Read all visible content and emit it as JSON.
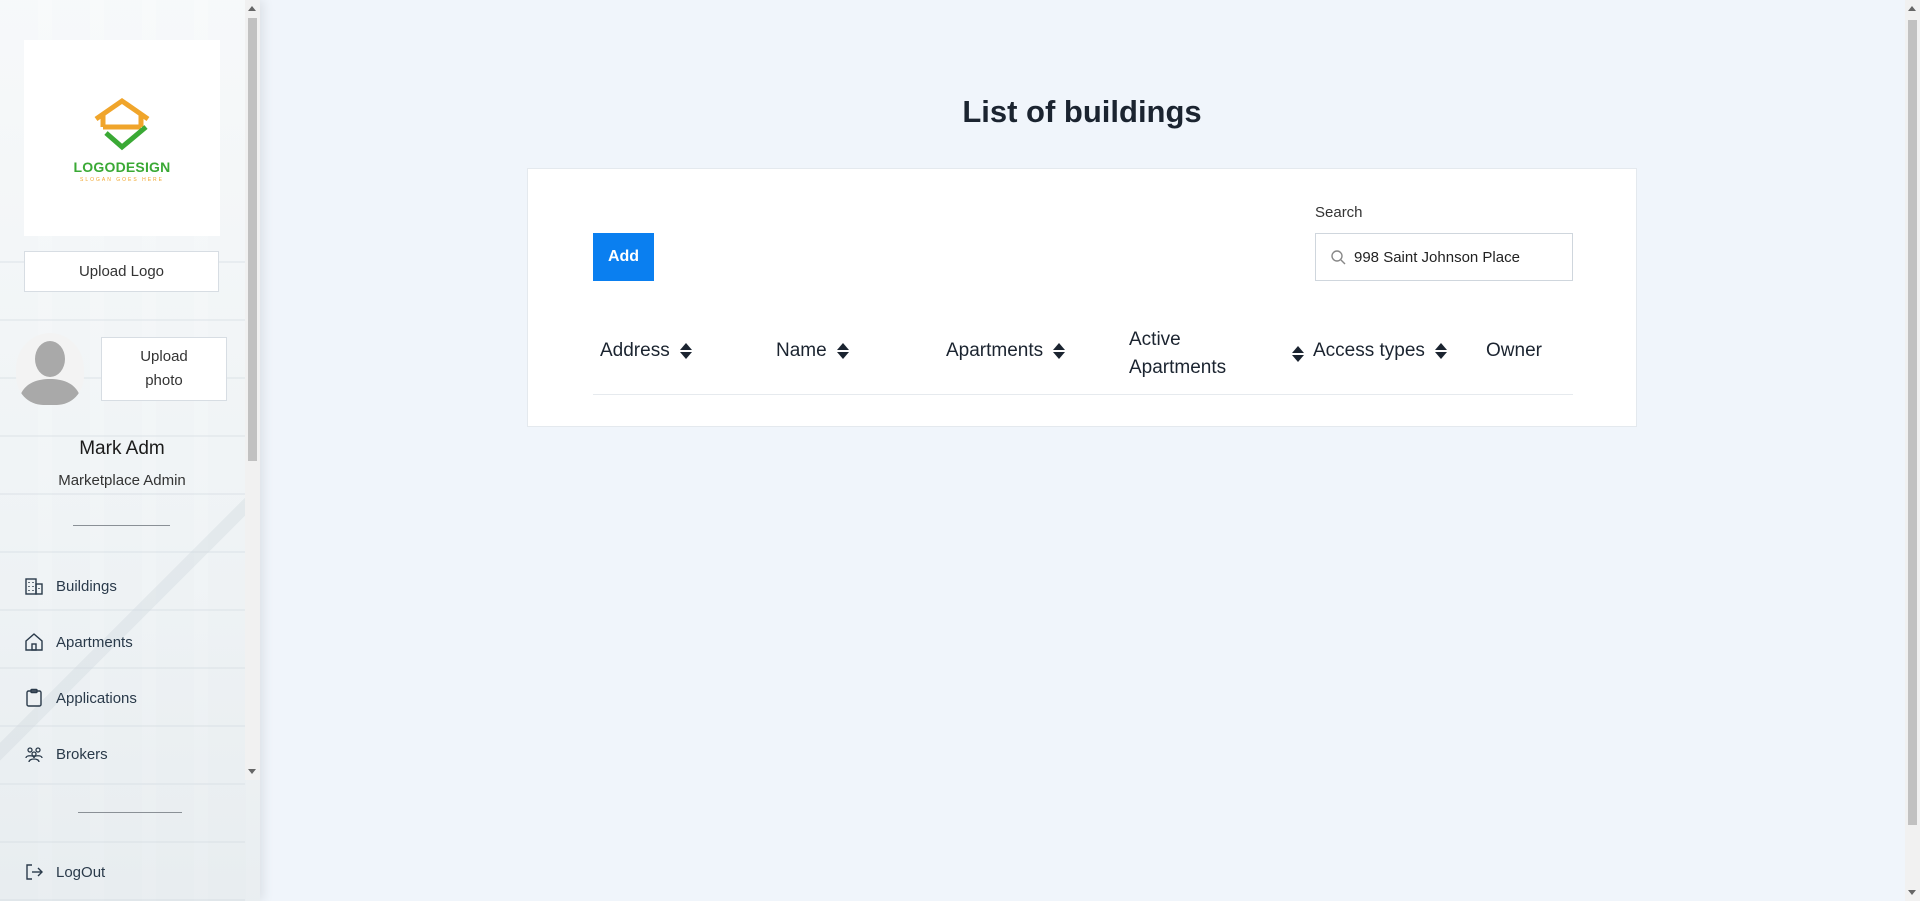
{
  "sidebar": {
    "logo": {
      "brand": "LOGODESIGN",
      "tagline": "SLOGAN GOES HERE"
    },
    "upload_logo_label": "Upload Logo",
    "upload_photo_label": "Upload photo",
    "user": {
      "name": "Mark Adm",
      "role": "Marketplace Admin"
    },
    "nav": [
      {
        "label": "Buildings",
        "icon": "building-icon"
      },
      {
        "label": "Apartments",
        "icon": "home-icon"
      },
      {
        "label": "Applications",
        "icon": "clipboard-icon"
      },
      {
        "label": "Brokers",
        "icon": "people-icon"
      }
    ],
    "logout_label": "LogOut"
  },
  "main": {
    "title": "List of buildings",
    "add_label": "Add",
    "search": {
      "label": "Search",
      "value": "998 Saint Johnson Place"
    },
    "columns": [
      {
        "label": "Address",
        "sortable": true
      },
      {
        "label": "Name",
        "sortable": true
      },
      {
        "label": "Apartments",
        "sortable": true
      },
      {
        "label": "Active Apartments",
        "sortable": true
      },
      {
        "label": "Access types",
        "sortable": true
      },
      {
        "label": "Owner",
        "sortable": false
      }
    ]
  },
  "colors": {
    "primary": "#0a7ff0",
    "background": "#f0f5fb",
    "logo_green": "#3aa935",
    "logo_orange": "#f0a52b"
  }
}
